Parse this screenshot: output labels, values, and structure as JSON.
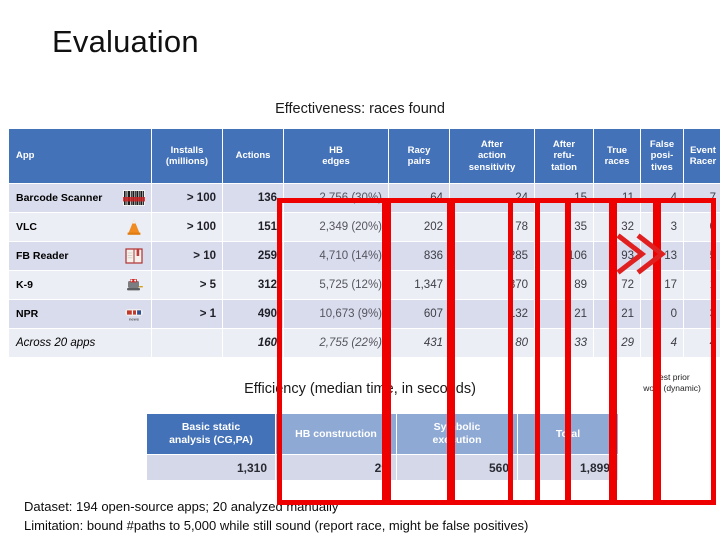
{
  "slide": {
    "title": "Evaluation",
    "effectiveness_caption": "Effectiveness: races found",
    "efficiency_caption": "Efficiency (median time, in seconds)"
  },
  "effectiveness_table": {
    "columns": [
      "App",
      "Installs (millions)",
      "Actions",
      "HB edges",
      "Racy pairs",
      "After action sensitivity",
      "After refutation",
      "True races",
      "False positives",
      "Event Racer"
    ],
    "column_labels_wrapped": {
      "app": "App",
      "installs_line1": "Installs",
      "installs_line2": "(millions)",
      "actions": "Actions",
      "hb_line1": "HB",
      "hb_line2": "edges",
      "racy_line1": "Racy",
      "racy_line2": "pairs",
      "after_action_line1": "After",
      "after_action_line2": "action",
      "after_action_line3": "sensitivity",
      "after_refu_line1": "After",
      "after_refu_line2": "refu-",
      "after_refu_line3": "tation",
      "true_line1": "True",
      "true_line2": "races",
      "false_line1": "False",
      "false_line2": "posi-",
      "false_line3": "tives",
      "event_line1": "Event",
      "event_line2": "Racer"
    },
    "rows": [
      {
        "app": "Barcode Scanner",
        "icon": "barcode-icon",
        "installs": "> 100",
        "actions": "136",
        "hb_edges": "2,756 (30%)",
        "racy_pairs": "64",
        "after_action_sensitivity": "24",
        "after_refutation": "15",
        "true_races": "11",
        "false_positives": "4",
        "event_racer": "7"
      },
      {
        "app": "VLC",
        "icon": "vlc-cone-icon",
        "installs": "> 100",
        "actions": "151",
        "hb_edges": "2,349 (20%)",
        "racy_pairs": "202",
        "after_action_sensitivity": "78",
        "after_refutation": "35",
        "true_races": "32",
        "false_positives": "3",
        "event_racer": "0"
      },
      {
        "app": "FB Reader",
        "icon": "book-icon",
        "installs": "> 10",
        "actions": "259",
        "hb_edges": "4,710 (14%)",
        "racy_pairs": "836",
        "after_action_sensitivity": "285",
        "after_refutation": "106",
        "true_races": "93",
        "false_positives": "13",
        "event_racer": "5"
      },
      {
        "app": "K-9",
        "icon": "k9-robot-icon",
        "installs": "> 5",
        "actions": "312",
        "hb_edges": "5,725 (12%)",
        "racy_pairs": "1,347",
        "after_action_sensitivity": "370",
        "after_refutation": "89",
        "true_races": "72",
        "false_positives": "17",
        "event_racer": "1"
      },
      {
        "app": "NPR",
        "icon": "npr-logo-icon",
        "installs": "> 1",
        "actions": "490",
        "hb_edges": "10,673 (9%)",
        "racy_pairs": "607",
        "after_action_sensitivity": "132",
        "after_refutation": "21",
        "true_races": "21",
        "false_positives": "0",
        "event_racer": "3"
      },
      {
        "app": "Across 20 apps",
        "icon": "",
        "installs": "",
        "actions": "160",
        "hb_edges": "2,755 (22%)",
        "racy_pairs": "431",
        "after_action_sensitivity": "80",
        "after_refutation": "33",
        "true_races": "29",
        "false_positives": "4",
        "event_racer": "4"
      }
    ]
  },
  "efficiency_table": {
    "headers": {
      "basic_line1": "Basic static",
      "basic_line2": "analysis (CG,PA)",
      "hb_construction": "HB construction",
      "symbolic_line1": "Symbolic",
      "symbolic_line2": "execution",
      "total": "Total"
    },
    "values": {
      "basic_static_analysis": "1,310",
      "hb_construction": "29",
      "symbolic_execution": "560",
      "total": "1,899"
    }
  },
  "annotations": {
    "best_prior_line1": "best prior",
    "best_prior_line2": "work (dynamic)",
    "highlight_color": "#ee0000"
  },
  "footer": {
    "dataset_line": "Dataset: 194 open-source apps; 20 analyzed manually",
    "limitation_line": "Limitation: bound #paths to 5,000 while still sound (report race, might be false positives)"
  }
}
